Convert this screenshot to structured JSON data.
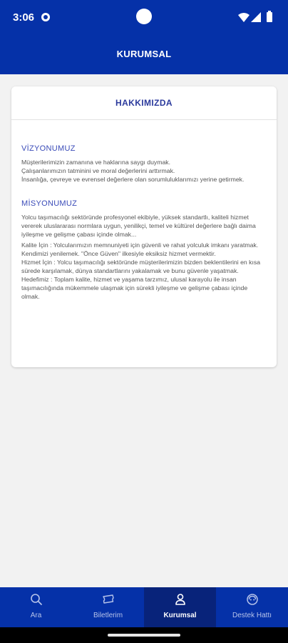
{
  "status_bar": {
    "time": "3:06"
  },
  "header": {
    "title": "KURUMSAL"
  },
  "card": {
    "title": "HAKKIMIZDA",
    "vision": {
      "title": "VİZYONUMUZ",
      "paragraphs": [
        "Müşterilerimizin zamanına ve haklarına saygı duymak.\n Çalışanlarımızın tatminini ve moral değerlerini arttırmak.\n İnsanlığa, çevreye ve evrensel değerlere olan sorumluluklarımızı yerine getirmek."
      ]
    },
    "mission": {
      "title": "MİSYONUMUZ",
      "paragraphs": [
        "Yolcu taşımacılığı sektöründe profesyonel ekibiyle, yüksek standartlı, kaliteli hizmet vererek uluslararası normlara uygun, yenilikçi, temel ve kültürel değerlere bağlı daima iyileşme ve gelişme çabası içinde olmak...",
        "Kalite İçin : Yolcularımızın memnuniyeti için güvenli ve rahat yolculuk imkanı yaratmak. Kendimizi yenilemek. \"Önce Güven\" ilkesiyle eksiksiz hizmet vermektir.\n Hizmet İçin : Yolcu taşımacılığı sektöründe müşterilerimizin bizden beklentilerini en kısa sürede karşılamak, dünya standartlarını yakalamak ve bunu güvenle yaşatmak.\n Hedefimiz : Toplam kalite, hizmet ve yaşama tarzımız, ulusal karayolu ile insan taşımacılığında mükemmele ulaşmak için sürekli iyileşme ve gelişme çabası içinde olmak."
      ]
    }
  },
  "bottom_nav": {
    "items": [
      {
        "label": "Ara",
        "icon": "search-icon",
        "active": false
      },
      {
        "label": "Biletlerim",
        "icon": "ticket-icon",
        "active": false
      },
      {
        "label": "Kurumsal",
        "icon": "user-icon",
        "active": true
      },
      {
        "label": "Destek Hattı",
        "icon": "support-icon",
        "active": false
      }
    ]
  },
  "colors": {
    "primary": "#0531a8",
    "nav_active": "#08237a",
    "section_title": "#3a4bb8",
    "background": "#f2f2f2"
  }
}
